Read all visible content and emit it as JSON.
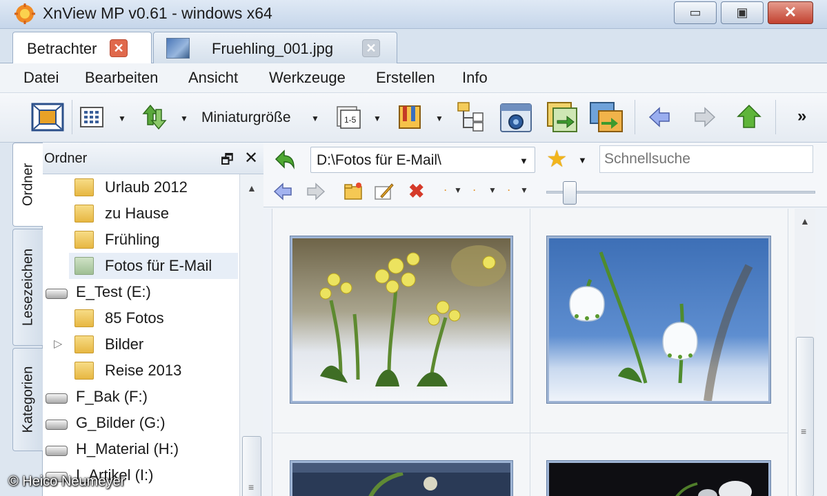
{
  "window": {
    "title": "XnView MP v0.61 - windows x64",
    "min_glyph": "▭",
    "max_glyph": "▣",
    "close_glyph": "✕"
  },
  "tabs": [
    {
      "label": "Betrachter",
      "close": "✕"
    },
    {
      "label": "Fruehling_001.jpg",
      "close": "✕"
    }
  ],
  "menu": [
    "Datei",
    "Bearbeiten",
    "Ansicht",
    "Werkzeuge",
    "Erstellen",
    "Info"
  ],
  "toolbar": {
    "thumbnail_size_label": "Miniaturgröße",
    "dropdown_glyph": "▼",
    "overflow_glyph": "»"
  },
  "side_tabs": [
    "Ordner",
    "Lesezeichen",
    "Kategorien"
  ],
  "folder_panel": {
    "title": "Ordner",
    "float_glyph": "🗗",
    "close_glyph": "✕",
    "items": [
      {
        "label": "Urlaub 2012",
        "type": "folder"
      },
      {
        "label": "zu Hause",
        "type": "folder"
      },
      {
        "label": "Frühling",
        "type": "folder"
      },
      {
        "label": "Fotos für E-Mail",
        "type": "folder",
        "selected": true
      },
      {
        "label": "E_Test (E:)",
        "type": "drive"
      },
      {
        "label": "85 Fotos",
        "type": "folder"
      },
      {
        "label": "Bilder",
        "type": "folder",
        "expandable": true
      },
      {
        "label": "Reise 2013",
        "type": "folder"
      },
      {
        "label": "F_Bak (F:)",
        "type": "drive"
      },
      {
        "label": "G_Bilder (G:)",
        "type": "drive"
      },
      {
        "label": "H_Material (H:)",
        "type": "drive"
      },
      {
        "label": "I_Artikel (I:)",
        "type": "drive"
      }
    ],
    "expander_glyph": "▷"
  },
  "browser": {
    "path": "D:\\Fotos für E-Mail\\",
    "search_placeholder": "Schnellsuche",
    "dot_glyph": "·"
  },
  "credit": "© Heico Neumeyer",
  "colors": {
    "title_bar": "#c6d6ea",
    "selected_row": "#e7eef7",
    "folder": "#e7b742",
    "close_button": "#c2412f"
  }
}
